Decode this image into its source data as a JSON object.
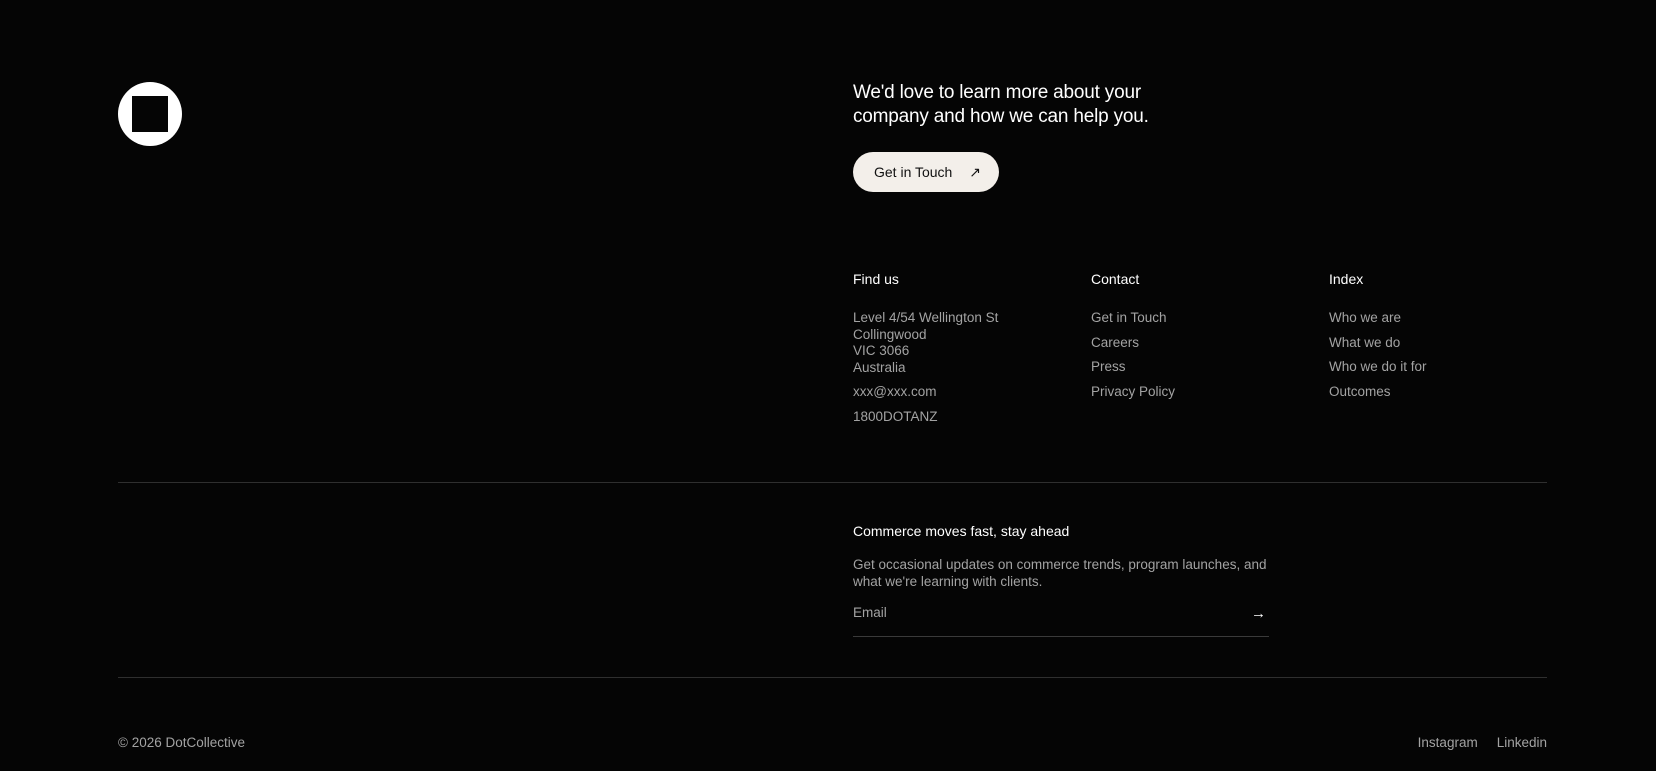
{
  "cta": {
    "heading": "We'd love to learn more about your company and how we can help you.",
    "button_label": "Get in Touch",
    "button_icon": "arrow-up-right-icon"
  },
  "find_us": {
    "title": "Find us",
    "address_lines": [
      "Level 4/54 Wellington St",
      "Collingwood",
      "VIC 3066",
      "Australia"
    ],
    "email": "xxx@xxx.com",
    "phone": "1800DOTANZ"
  },
  "contact": {
    "title": "Contact",
    "links": [
      "Get in Touch",
      "Careers",
      "Press",
      "Privacy Policy"
    ]
  },
  "index": {
    "title": "Index",
    "links": [
      "Who we are",
      "What we do",
      "Who we do it for",
      "Outcomes"
    ]
  },
  "newsletter": {
    "title": "Commerce moves fast, stay ahead",
    "description": "Get occasional updates on commerce trends, program launches, and what we're learning with clients.",
    "email_placeholder": "Email",
    "submit_icon": "arrow-right-icon"
  },
  "footer": {
    "copyright": "© 2026 DotCollective",
    "social_links": [
      "Instagram",
      "Linkedin"
    ]
  },
  "colors": {
    "background": "#050505",
    "button_bg": "#f3efea",
    "muted_text": "#a3a3a3",
    "divider": "#2f2f2f"
  }
}
